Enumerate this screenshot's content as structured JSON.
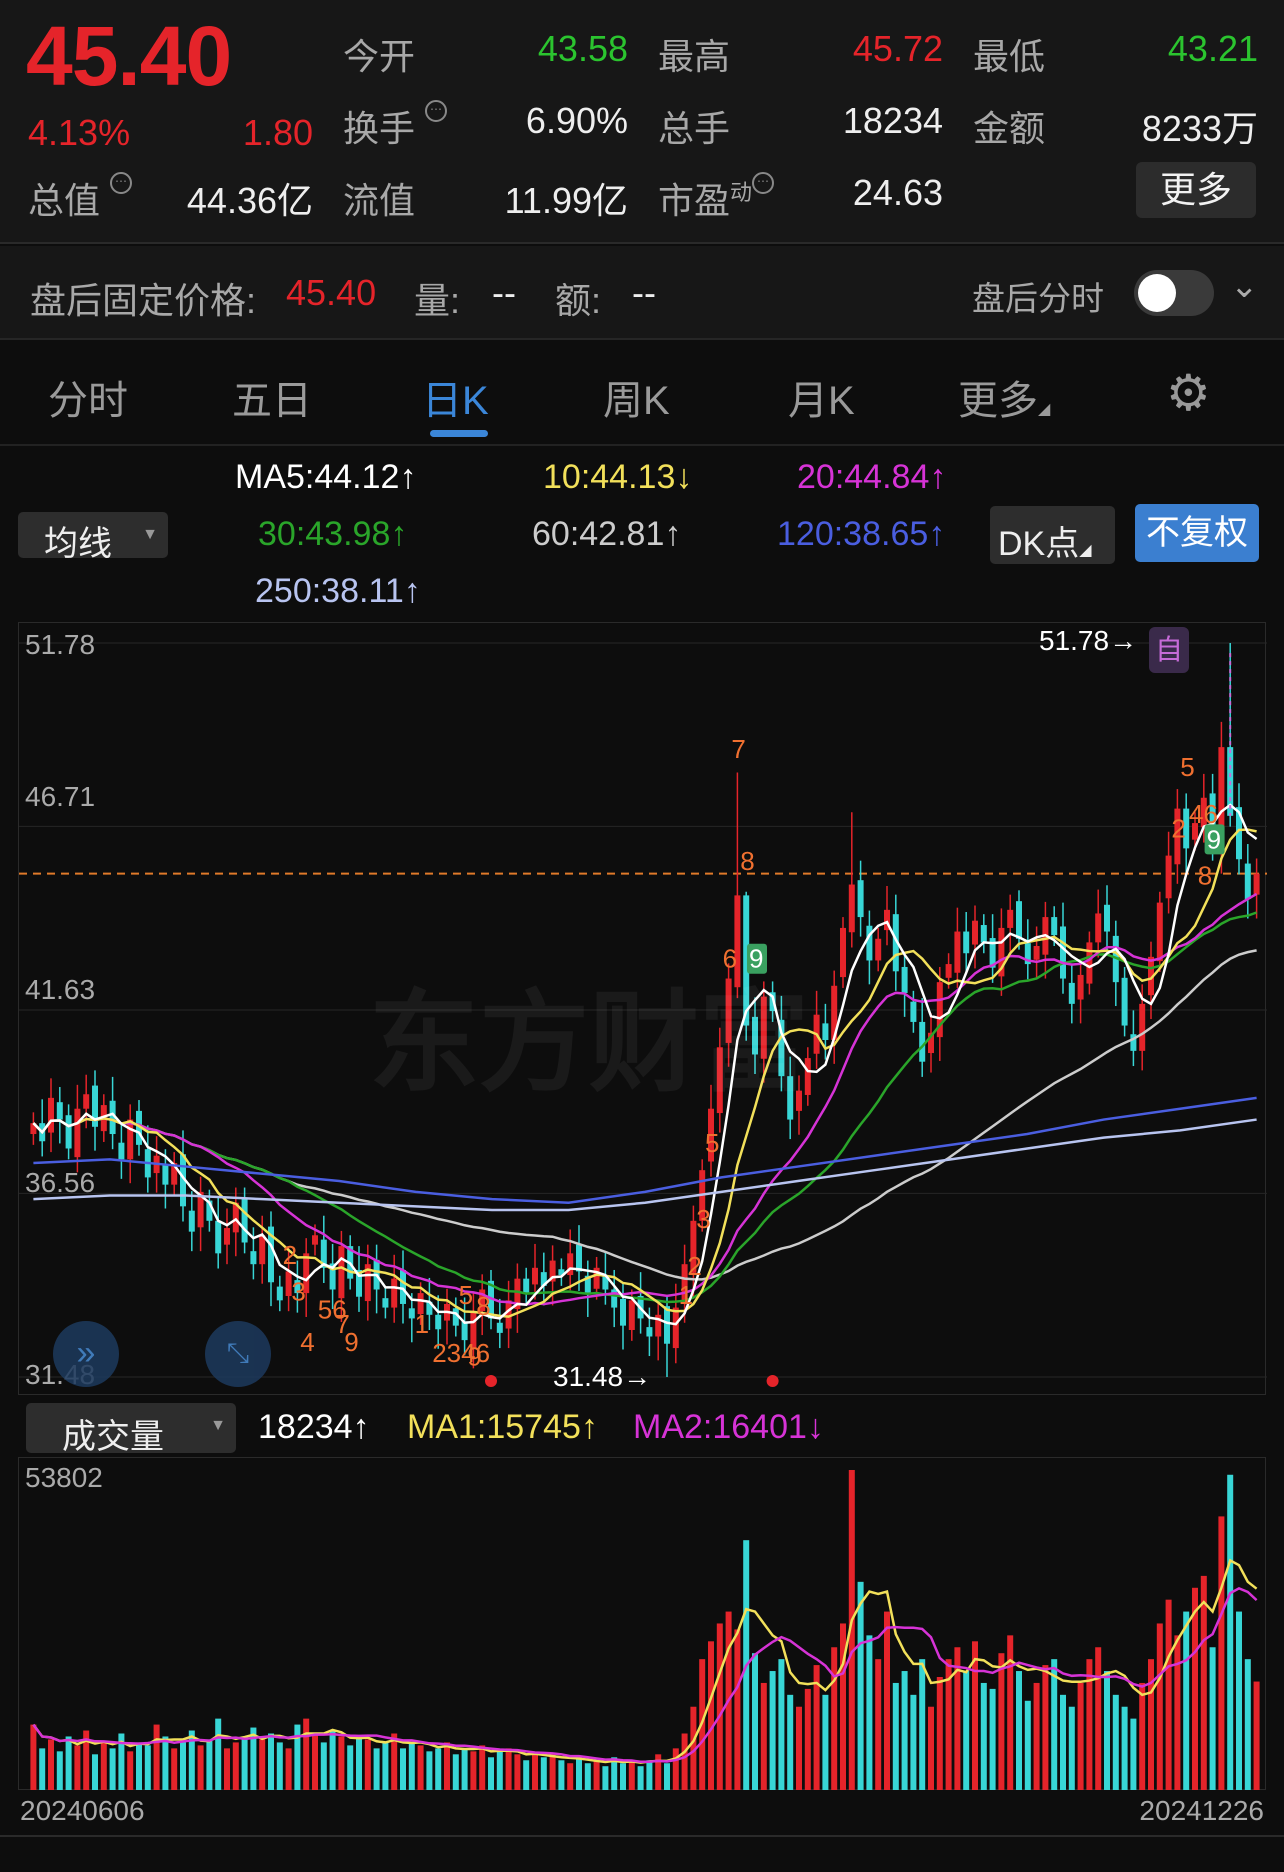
{
  "quote": {
    "price": "45.40",
    "change_pct": "4.13%",
    "change": "1.80",
    "open_label": "今开",
    "open": "43.58",
    "high_label": "最高",
    "high": "45.72",
    "low_label": "最低",
    "low": "43.21",
    "turnover_label": "换手",
    "turnover": "6.90%",
    "volume_label": "总手",
    "volume": "18234",
    "amount_label": "金额",
    "amount": "8233万",
    "mktcap_label": "总值",
    "mktcap": "44.36亿",
    "float_label": "流值",
    "float": "11.99亿",
    "pe_label": "市盈",
    "pe_sup": "动",
    "pe": "24.63",
    "more": "更多",
    "info_icon": "⋯"
  },
  "post": {
    "price_label": "盘后固定价格:",
    "price": "45.40",
    "vol_label": "量:",
    "vol": "--",
    "amt_label": "额:",
    "amt": "--",
    "intraday_label": "盘后分时",
    "toggle_on": false
  },
  "tabs": [
    {
      "label": "分时"
    },
    {
      "label": "五日"
    },
    {
      "label": "日K",
      "active": true
    },
    {
      "label": "周K"
    },
    {
      "label": "月K"
    },
    {
      "label": "更多"
    }
  ],
  "ma": {
    "selector": "均线",
    "ma5": "MA5:44.12↑",
    "ma10": "10:44.13↓",
    "ma20": "20:44.84↑",
    "ma30": "30:43.98↑",
    "ma60": "60:42.81↑",
    "ma120": "120:38.65↑",
    "ma250": "250:38.11↑",
    "dk": "DK点",
    "adjust": "不复权"
  },
  "colors": {
    "up": "#e5242a",
    "down": "#38d6d6",
    "ma5": "#ffffff",
    "ma10": "#f2e05a",
    "ma20": "#d633d6",
    "ma30": "#2aa52a",
    "ma60": "#cccccc",
    "ma120": "#4a5ee0",
    "ma250": "#b8c4f0",
    "accent": "#3b86d8"
  },
  "volume_header": {
    "selector": "成交量",
    "vol": "18234↑",
    "ma1": "MA1:15745↑",
    "ma2": "MA2:16401↓",
    "max_label": "53802"
  },
  "dates": {
    "start": "20240606",
    "end": "20241226"
  },
  "watermark": "东方财富",
  "chart_data": {
    "type": "candlestick",
    "y_ticks": [
      "51.78",
      "46.71",
      "41.63",
      "36.56",
      "31.48"
    ],
    "ylim": [
      31.48,
      51.78
    ],
    "current_price": 45.4,
    "max_label": "51.78→",
    "min_label": "31.48→",
    "max_badge": "自",
    "close": [
      38.5,
      38.0,
      39.2,
      38.6,
      37.8,
      38.9,
      39.3,
      38.4,
      39.0,
      38.2,
      37.5,
      38.6,
      37.9,
      37.0,
      37.6,
      36.8,
      37.4,
      36.2,
      35.5,
      36.6,
      35.8,
      34.9,
      35.6,
      36.3,
      35.2,
      34.6,
      35.4,
      34.1,
      33.6,
      34.4,
      33.8,
      34.9,
      35.4,
      34.5,
      33.9,
      35.1,
      34.2,
      33.7,
      34.6,
      33.9,
      33.4,
      34.2,
      33.5,
      33.1,
      33.8,
      33.2,
      32.8,
      33.5,
      32.9,
      32.5,
      33.3,
      33.9,
      33.1,
      32.7,
      33.6,
      34.2,
      33.8,
      34.5,
      34.0,
      34.7,
      34.3,
      34.9,
      34.4,
      33.8,
      34.5,
      33.9,
      33.4,
      32.9,
      33.6,
      33.1,
      32.6,
      33.2,
      32.4,
      33.4,
      34.6,
      35.8,
      37.2,
      38.9,
      40.6,
      42.5,
      44.8,
      41.2,
      40.4,
      42.0,
      41.6,
      39.8,
      38.6,
      39.4,
      40.3,
      41.5,
      40.8,
      42.3,
      43.9,
      45.1,
      44.2,
      43.0,
      43.6,
      44.4,
      42.7,
      42.1,
      41.3,
      40.2,
      41.0,
      42.4,
      42.9,
      43.8,
      43.2,
      44.1,
      43.5,
      42.8,
      43.9,
      44.4,
      43.6,
      42.9,
      43.4,
      44.2,
      43.7,
      42.5,
      41.8,
      42.6,
      43.5,
      44.3,
      43.8,
      42.4,
      41.2,
      40.5,
      41.8,
      43.1,
      44.6,
      45.9,
      47.2,
      46.1,
      46.8,
      47.5,
      46.3,
      48.9,
      47.0,
      45.8,
      44.7,
      45.4
    ],
    "high_overrides": {
      "80": 48.2,
      "81": 44.9,
      "93": 47.1,
      "136": 51.78,
      "135": 49.6
    },
    "low_overrides": {
      "72": 31.48
    },
    "ma120": [
      37.4,
      37.5,
      37.3,
      37.1,
      36.9,
      36.6,
      36.4,
      36.3,
      36.6,
      37.0,
      37.3,
      37.6,
      37.9,
      38.2,
      38.6,
      38.9,
      39.2
    ],
    "ma250": [
      36.4,
      36.5,
      36.5,
      36.4,
      36.3,
      36.2,
      36.1,
      36.1,
      36.3,
      36.6,
      36.9,
      37.2,
      37.5,
      37.8,
      38.1,
      38.3,
      38.6
    ],
    "volumes": [
      11000,
      7000,
      8500,
      6500,
      9000,
      7500,
      10000,
      6000,
      8000,
      7000,
      9500,
      6500,
      8000,
      7500,
      11000,
      9000,
      7000,
      8000,
      10000,
      7500,
      8500,
      12000,
      7000,
      8000,
      9000,
      10500,
      8500,
      9500,
      8000,
      7000,
      11000,
      12000,
      9500,
      8000,
      10000,
      9000,
      7500,
      9000,
      8500,
      7000,
      8000,
      9500,
      7000,
      8000,
      7500,
      6500,
      7000,
      8000,
      6000,
      7000,
      6500,
      7500,
      5500,
      6500,
      7000,
      6000,
      5000,
      6000,
      5500,
      6000,
      5000,
      4500,
      5500,
      4500,
      5000,
      4000,
      5500,
      4500,
      5000,
      4000,
      5000,
      6000,
      4500,
      7000,
      9500,
      14000,
      22000,
      25000,
      28000,
      30000,
      27000,
      42000,
      23000,
      18000,
      20000,
      22000,
      16000,
      14000,
      17000,
      21000,
      16000,
      24000,
      28000,
      53802,
      35000,
      26000,
      22000,
      30000,
      18000,
      20000,
      16000,
      22000,
      14000,
      19000,
      22000,
      24000,
      20000,
      25000,
      18000,
      17000,
      23000,
      26000,
      20000,
      15000,
      18000,
      21000,
      22000,
      16000,
      14000,
      18000,
      22000,
      24000,
      20000,
      16000,
      14000,
      12000,
      18000,
      22000,
      28000,
      32000,
      26000,
      30000,
      34000,
      36000,
      24000,
      46000,
      53000,
      30000,
      22000,
      18234
    ],
    "td_marks": [
      {
        "i": 80,
        "text": "7",
        "p": 48.6
      },
      {
        "i": 79,
        "text": "6",
        "p": 42.8
      },
      {
        "i": 81,
        "text": "8",
        "p": 45.5
      },
      {
        "i": 82,
        "text": "9",
        "p": 42.8,
        "green": true
      },
      {
        "i": 77,
        "text": "5",
        "p": 37.7
      },
      {
        "i": 76,
        "text": "3",
        "p": 35.6
      },
      {
        "i": 75,
        "text": "2",
        "p": 34.3
      },
      {
        "i": 74,
        "text": "1",
        "p": 33.5
      },
      {
        "i": 131,
        "text": "5",
        "p": 48.1
      },
      {
        "i": 130,
        "text": "2",
        "p": 46.4
      },
      {
        "i": 132,
        "text": "46",
        "p": 46.8
      },
      {
        "i": 134,
        "text": "9",
        "p": 46.1,
        "green": true
      },
      {
        "i": 133,
        "text": "8",
        "p": 45.1
      },
      {
        "i": 29,
        "text": "2",
        "p": 34.6
      },
      {
        "i": 30,
        "text": "3",
        "p": 33.6
      },
      {
        "i": 33,
        "text": "56",
        "p": 33.1
      },
      {
        "i": 31,
        "text": "4",
        "p": 32.2
      },
      {
        "i": 35,
        "text": "7",
        "p": 32.7
      },
      {
        "i": 36,
        "text": "9",
        "p": 32.2
      },
      {
        "i": 49,
        "text": "5",
        "p": 33.5
      },
      {
        "i": 51,
        "text": "8",
        "p": 33.2
      },
      {
        "i": 44,
        "text": "1",
        "p": 32.7
      },
      {
        "i": 46,
        "text": "2346",
        "p": 31.9
      },
      {
        "i": 50,
        "text": "9",
        "p": 31.8
      }
    ]
  }
}
